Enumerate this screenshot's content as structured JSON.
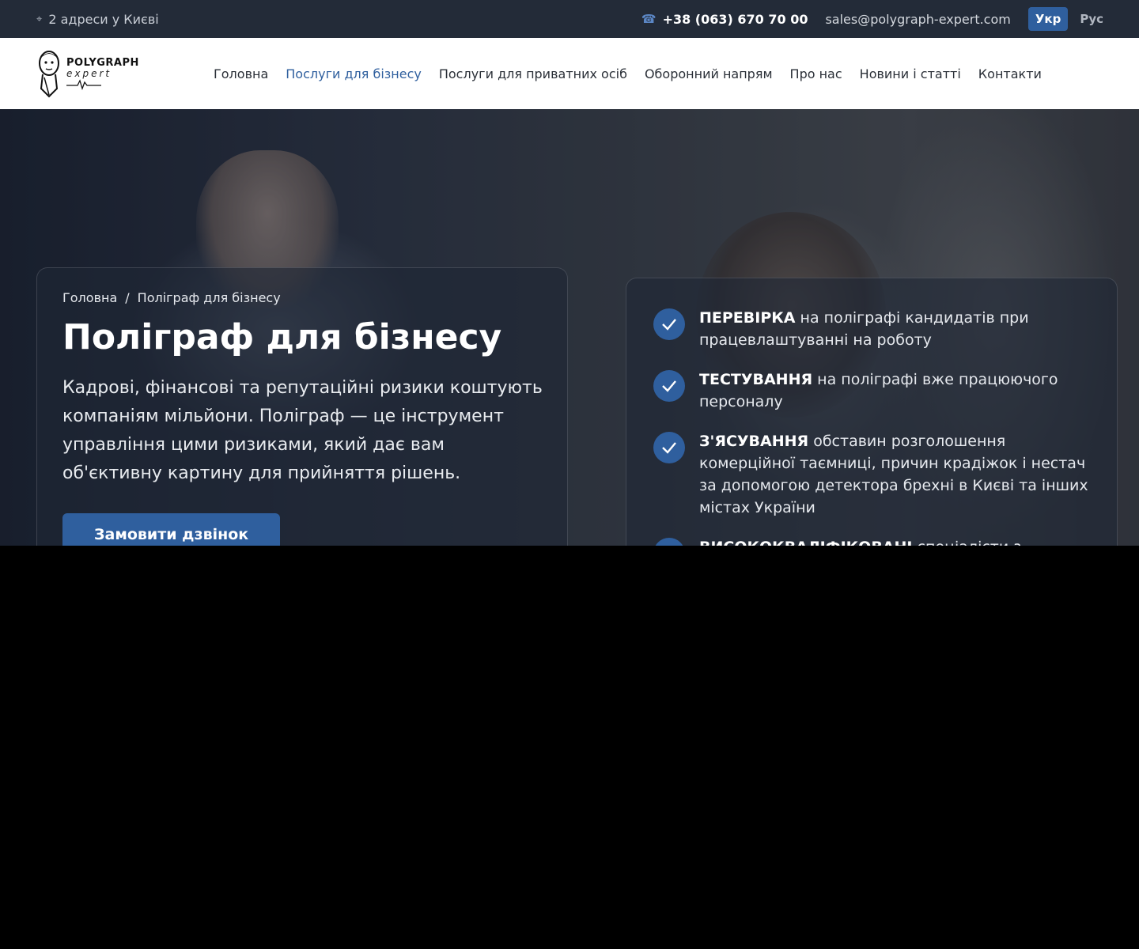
{
  "topbar": {
    "address": "2 адреси у Києві",
    "phone": "+38 (063) 670 70 00",
    "email": "sales@polygraph-expert.com",
    "languages": [
      {
        "label": "Укр",
        "active": true
      },
      {
        "label": "Рус",
        "active": false
      }
    ]
  },
  "logo": {
    "brand": "POLYGRAPH",
    "sub": "expert"
  },
  "nav": [
    {
      "label": "Головна"
    },
    {
      "label": "Послуги для бізнесу",
      "active": true
    },
    {
      "label": "Послуги для приватних осіб"
    },
    {
      "label": "Оборонний напрям"
    },
    {
      "label": "Про нас"
    },
    {
      "label": "Новини і статті"
    },
    {
      "label": "Контакти"
    }
  ],
  "hero": {
    "breadcrumb": {
      "home": "Головна",
      "separator": "/",
      "current": "Поліграф для бізнесу"
    },
    "title": "Поліграф для бізнесу",
    "lead": "Кадрові, фінансові та репутаційні ризики коштують компаніям мільйони. Поліграф — це інструмент управління цими ризиками, який дає вам об'єктивну картину для прийняття рішень.",
    "cta": "Замовити дзвінок"
  },
  "features": [
    {
      "bold": "ПЕРЕВІРКА",
      "text": " на поліграфі кандидатів при працевлаштуванні на роботу"
    },
    {
      "bold": "ТЕСТУВАННЯ",
      "text": " на поліграфі вже працюючого персоналу"
    },
    {
      "bold": "З'ЯСУВАННЯ",
      "text": " обставин розголошення комерційної таємниці, причин крадіжок і нестач за допомогою детектора брехні в Києві та інших містах України"
    },
    {
      "bold": "ВИСОКОКВАЛІФІКОВАНІ",
      "text": " спеціалісти з"
    }
  ],
  "colors": {
    "accent": "#2f5f9e",
    "topbar": "#232b38"
  }
}
